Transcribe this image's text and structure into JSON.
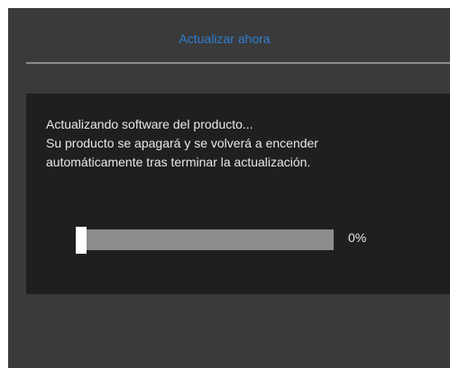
{
  "header": {
    "title": "Actualizar ahora"
  },
  "dialog": {
    "lines": [
      "Actualizando software del producto...",
      "Su producto se apagará y se volverá a encender",
      "automáticamente tras terminar la actualización."
    ],
    "progress": {
      "value": 0,
      "label": "0%"
    }
  },
  "colors": {
    "title": "#2f7fd0",
    "screen_bg": "#3a3a3a",
    "dialog_bg": "#1f1f1f",
    "track": "#8c8c8c",
    "handle": "#ffffff"
  }
}
